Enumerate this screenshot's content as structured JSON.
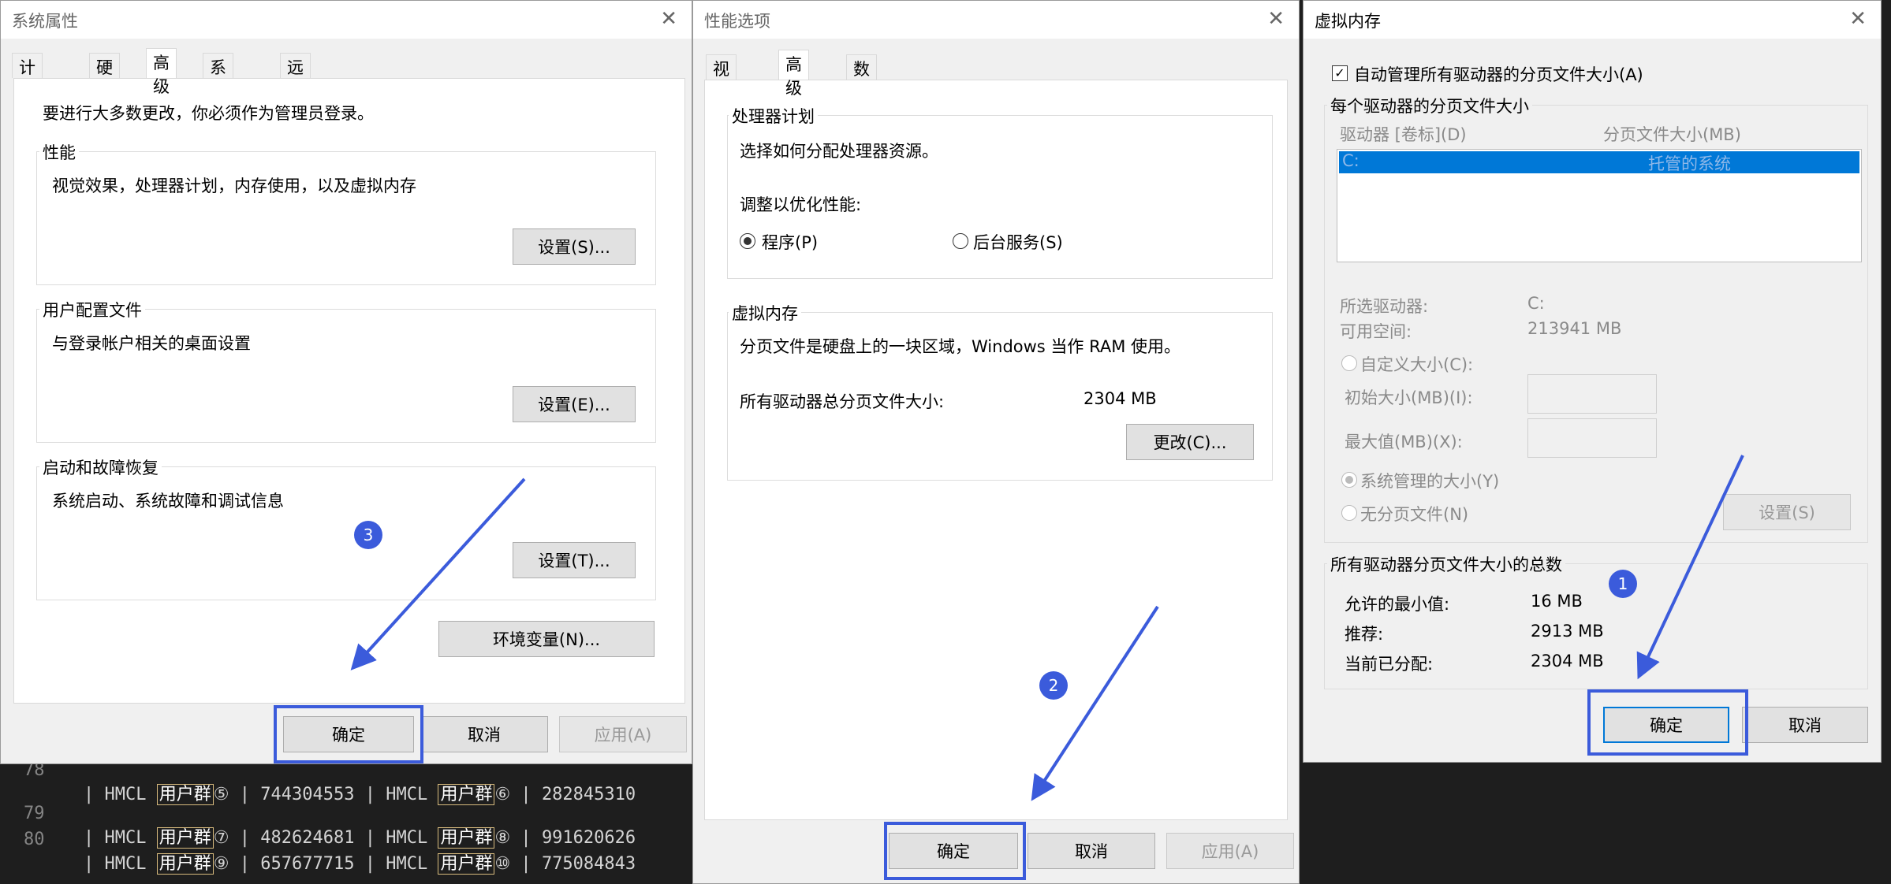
{
  "editor": {
    "lines": [
      {
        "num": "78",
        "name": "HMCL",
        "group": "用户群",
        "mark1": "⑤",
        "id1": "744304553",
        "mark2": "⑥",
        "id2": "282845310"
      },
      {
        "num": "79",
        "name": "HMCL",
        "group": "用户群",
        "mark1": "⑦",
        "id1": "482624681",
        "mark2": "⑧",
        "id2": "991620626"
      },
      {
        "num": "80",
        "name": "HMCL",
        "group": "用户群",
        "mark1": "⑨",
        "id1": "657677715",
        "mark2": "⑩",
        "id2": "775084843"
      }
    ]
  },
  "sysprops": {
    "title": "系统属性",
    "tabs": [
      "计算机名",
      "硬件",
      "高级",
      "系统保护",
      "远程"
    ],
    "admin_note": "要进行大多数更改，你必须作为管理员登录。",
    "perf_label": "性能",
    "perf_desc": "视觉效果，处理器计划，内存使用，以及虚拟内存",
    "perf_btn": "设置(S)...",
    "profile_label": "用户配置文件",
    "profile_desc": "与登录帐户相关的桌面设置",
    "profile_btn": "设置(E)...",
    "startup_label": "启动和故障恢复",
    "startup_desc": "系统启动、系统故障和调试信息",
    "startup_btn": "设置(T)...",
    "env_btn": "环境变量(N)...",
    "ok": "确定",
    "cancel": "取消",
    "apply": "应用(A)"
  },
  "perfopts": {
    "title": "性能选项",
    "tabs": [
      "视觉效果",
      "高级",
      "数据执行保护"
    ],
    "cpu_label": "处理器计划",
    "cpu_desc": "选择如何分配处理器资源。",
    "optimize_label": "调整以优化性能:",
    "opt_programs": "程序(P)",
    "opt_services": "后台服务(S)",
    "vm_label": "虚拟内存",
    "vm_desc": "分页文件是硬盘上的一块区域，Windows 当作 RAM 使用。",
    "vm_total_label": "所有驱动器总分页文件大小:",
    "vm_total_value": "2304 MB",
    "change_btn": "更改(C)...",
    "ok": "确定",
    "cancel": "取消",
    "apply": "应用(A)"
  },
  "vmem": {
    "title": "虚拟内存",
    "auto_manage": "自动管理所有驱动器的分页文件大小(A)",
    "per_drive_label": "每个驱动器的分页文件大小",
    "col_drive": "驱动器 [卷标](D)",
    "col_size": "分页文件大小(MB)",
    "row_drive": "C:",
    "row_size": "托管的系统",
    "selected_drive_label": "所选驱动器:",
    "selected_drive_value": "C:",
    "free_space_label": "可用空间:",
    "free_space_value": "213941 MB",
    "custom_size": "自定义大小(C):",
    "initial_size": "初始大小(MB)(I):",
    "max_size": "最大值(MB)(X):",
    "system_managed": "系统管理的大小(Y)",
    "no_paging": "无分页文件(N)",
    "set_btn": "设置(S)",
    "total_label": "所有驱动器分页文件大小的总数",
    "min_label": "允许的最小值:",
    "min_value": "16 MB",
    "recommended_label": "推荐:",
    "recommended_value": "2913 MB",
    "current_label": "当前已分配:",
    "current_value": "2304 MB",
    "ok": "确定",
    "cancel": "取消"
  },
  "annotations": {
    "badge1": "1",
    "badge2": "2",
    "badge3": "3"
  },
  "colors": {
    "highlight": "#3b5bdb",
    "selection": "#0078d7"
  }
}
